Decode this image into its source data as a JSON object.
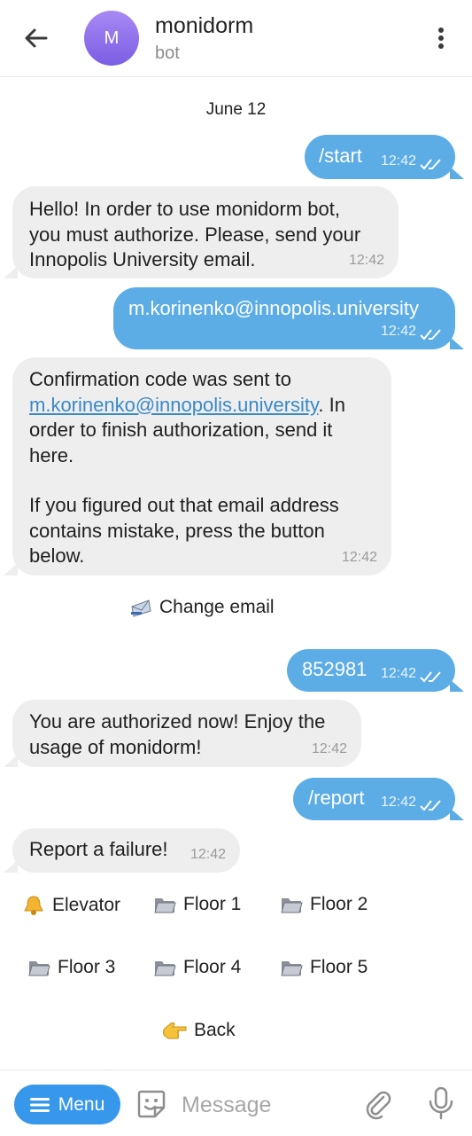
{
  "header": {
    "avatar_letter": "M",
    "title": "monidorm",
    "subtitle": "bot"
  },
  "date_label": "June 12",
  "messages": [
    {
      "text": "/start",
      "time": "12:42",
      "direction": "out"
    },
    {
      "lines": [
        "Hello! In order to use monidorm bot,",
        "you must authorize. Please, send your",
        "Innopolis University email."
      ],
      "time": "12:42",
      "direction": "in"
    },
    {
      "text": "m.korinenko@innopolis.university",
      "time": "12:42",
      "direction": "out"
    },
    {
      "prefix": "Confirmation code was sent to",
      "link": "m.korinenko@innopolis.university",
      "after_link": ". In",
      "lines": [
        "order to finish authorization, send it",
        "here.",
        "",
        "If you figured out that email address",
        "contains mistake, press the button",
        "below."
      ],
      "time": "12:42",
      "direction": "in"
    },
    {
      "text": "852981",
      "time": "12:42",
      "direction": "out"
    },
    {
      "lines": [
        "You are authorized now! Enjoy the",
        "usage of monidorm!"
      ],
      "time": "12:42",
      "direction": "in"
    },
    {
      "text": "/report",
      "time": "12:42",
      "direction": "out"
    },
    {
      "text": "Report a failure!",
      "time": "12:42",
      "direction": "in"
    }
  ],
  "inline_buttons": {
    "change_email": "Change email",
    "elevator": "Elevator",
    "floor1": "Floor 1",
    "floor2": "Floor 2",
    "floor3": "Floor 3",
    "floor4": "Floor 4",
    "floor5": "Floor 5",
    "back": "Back"
  },
  "icons": {
    "change_email": "envelope-icon",
    "elevator": "bell-icon",
    "floor": "folder-icon",
    "back": "pointing-hand-icon"
  },
  "composer": {
    "menu_label": "Menu",
    "placeholder": "Message"
  },
  "colors": {
    "outgoing_bubble": "#5cace6",
    "incoming_bubble": "#eeeeee",
    "menu_button": "#3797ea",
    "link": "#3a89c9",
    "avatar": "#8f72ee"
  }
}
